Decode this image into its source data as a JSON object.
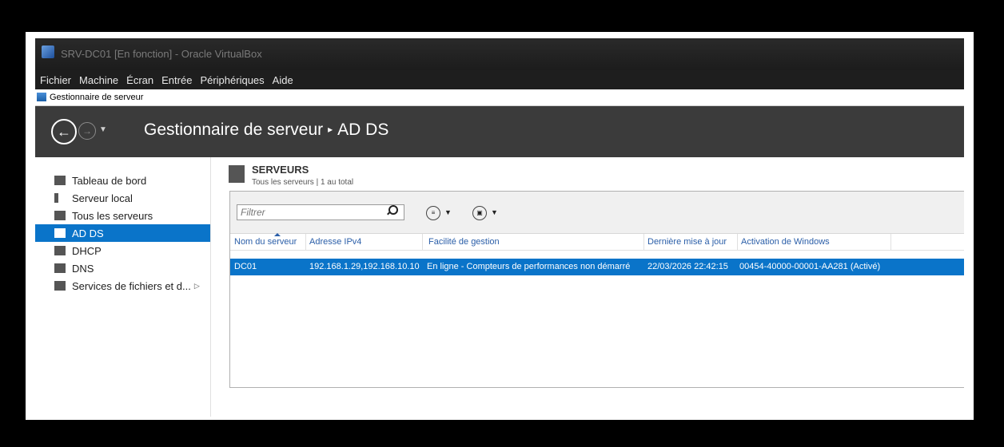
{
  "window": {
    "title": "SRV-DC01 [En fonction] - Oracle VirtualBox"
  },
  "menu": [
    "Fichier",
    "Machine",
    "Écran",
    "Entrée",
    "Périphériques",
    "Aide"
  ],
  "app_title": "Gestionnaire de serveur",
  "breadcrumb": {
    "root": "Gestionnaire de serveur",
    "separator": "▸",
    "current": "AD DS"
  },
  "sidebar": {
    "items": [
      {
        "label": "Tableau de bord",
        "icon": "dashboard-icon"
      },
      {
        "label": "Serveur local",
        "icon": "server-icon"
      },
      {
        "label": "Tous les serveurs",
        "icon": "servers-icon"
      },
      {
        "label": "AD DS",
        "icon": "adds-icon",
        "active": true
      },
      {
        "label": "DHCP",
        "icon": "dhcp-icon"
      },
      {
        "label": "DNS",
        "icon": "dns-icon"
      },
      {
        "label": "Services de fichiers et d...",
        "icon": "file-services-icon",
        "has_submenu": true
      }
    ]
  },
  "servers_tile": {
    "title": "SERVEURS",
    "subtitle": "Tous les serveurs | 1 au total",
    "filter_placeholder": "Filtrer",
    "columns": [
      "Nom du serveur",
      "Adresse IPv4",
      "Facilité de gestion",
      "Dernière mise à jour",
      "Activation de Windows"
    ],
    "rows": [
      {
        "name": "DC01",
        "ipv4": "192.168.1.29,192.168.10.10",
        "manageability": "En ligne - Compteurs de performances non démarré",
        "last_update": "22/03/2026 22:42:15",
        "activation": "00454-40000-00001-AA281 (Activé)"
      }
    ]
  },
  "colors": {
    "selection": "#0a74c9",
    "header_bg": "#3b3b3b",
    "titlebar": "#1e1e1e"
  }
}
